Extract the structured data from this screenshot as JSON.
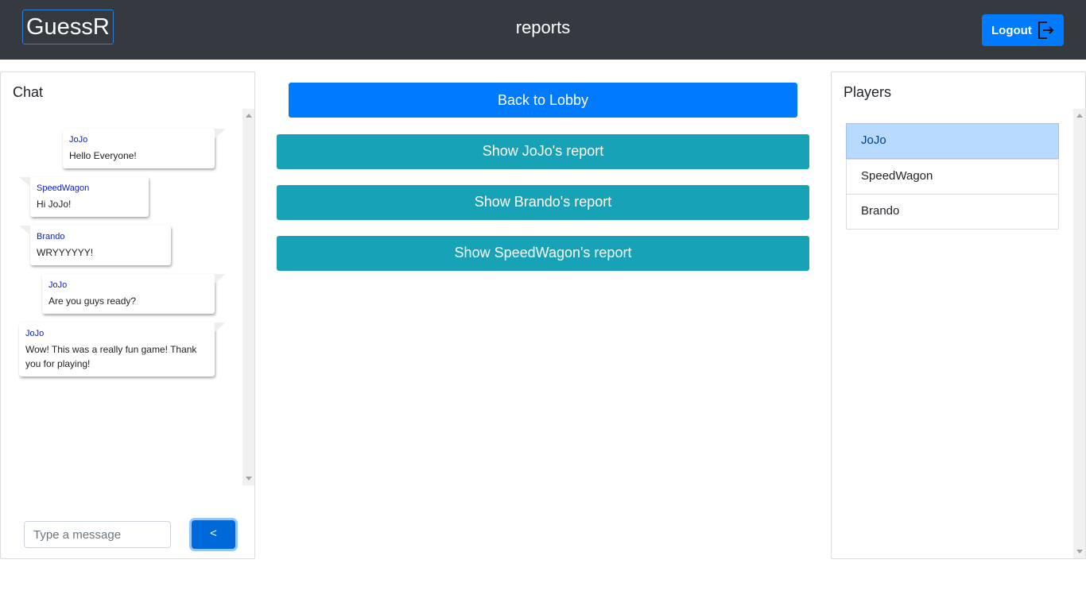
{
  "header": {
    "brand": "GuessR",
    "page_title": "reports",
    "logout_label": "Logout"
  },
  "chat": {
    "title": "Chat",
    "messages": [
      {
        "author": "JoJo",
        "text": "Hello Everyone!",
        "side": "right"
      },
      {
        "author": "SpeedWagon",
        "text": "Hi JoJo!",
        "side": "left"
      },
      {
        "author": "Brando",
        "text": "WRYYYYYY!",
        "side": "left"
      },
      {
        "author": "JoJo",
        "text": "Are you guys ready?",
        "side": "right"
      },
      {
        "author": "JoJo",
        "text": "Wow! This was a really fun game! Thank you for playing!",
        "side": "right"
      }
    ],
    "input_placeholder": "Type a message",
    "send_label": "<"
  },
  "main": {
    "back_label": "Back to Lobby",
    "reports": [
      "Show JoJo's report",
      "Show Brando's report",
      "Show SpeedWagon's report"
    ]
  },
  "players": {
    "title": "Players",
    "list": [
      "JoJo",
      "SpeedWagon",
      "Brando"
    ],
    "active_index": 0
  },
  "colors": {
    "navbar": "#343a40",
    "primary": "#007bff",
    "info": "#17a2b8",
    "active_item": "#b8daff",
    "author": "#0a1dc4"
  }
}
